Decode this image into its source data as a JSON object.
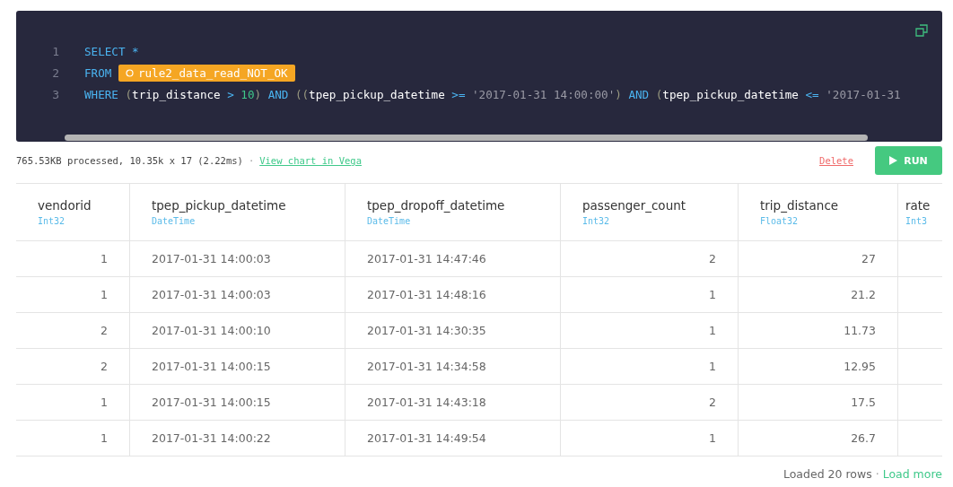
{
  "editor": {
    "lines": [
      {
        "number": "1",
        "tokens": [
          {
            "kind": "keyword",
            "text": "SELECT"
          },
          {
            "kind": "operator",
            "text": "*"
          }
        ]
      },
      {
        "number": "2",
        "tokens": [
          {
            "kind": "keyword",
            "text": "FROM"
          },
          {
            "kind": "table",
            "text": "rule2_data_read_NOT_OK"
          }
        ]
      },
      {
        "number": "3",
        "tokens": [
          {
            "kind": "keyword",
            "text": "WHERE"
          },
          {
            "kind": "paren_open",
            "text": "("
          },
          {
            "kind": "ident",
            "text": "trip_distance"
          },
          {
            "kind": "operator",
            "text": ">"
          },
          {
            "kind": "number",
            "text": "10"
          },
          {
            "kind": "paren_close",
            "text": ")"
          },
          {
            "kind": "keyword",
            "text": "AND"
          },
          {
            "kind": "paren_open",
            "text": "(("
          },
          {
            "kind": "ident",
            "text": "tpep_pickup_datetime"
          },
          {
            "kind": "operator",
            "text": ">="
          },
          {
            "kind": "string",
            "text": "'2017-01-31 14:00:00'"
          },
          {
            "kind": "paren_close",
            "text": ")"
          },
          {
            "kind": "keyword",
            "text": "AND"
          },
          {
            "kind": "paren_open",
            "text": "("
          },
          {
            "kind": "ident",
            "text": "tpep_pickup_datetime"
          },
          {
            "kind": "operator",
            "text": "<="
          },
          {
            "kind": "string",
            "text": "'2017-01-31"
          }
        ]
      }
    ]
  },
  "status": {
    "summary": "765.53KB processed, 10.35k x 17 (2.22ms)",
    "separator": "·",
    "link": "View chart in Vega"
  },
  "actions": {
    "delete": "Delete",
    "run": "RUN"
  },
  "table": {
    "columns": [
      {
        "name": "vendorid",
        "type": "Int32",
        "kind": "number"
      },
      {
        "name": "tpep_pickup_datetime",
        "type": "DateTime",
        "kind": "datetime"
      },
      {
        "name": "tpep_dropoff_datetime",
        "type": "DateTime",
        "kind": "datetime"
      },
      {
        "name": "passenger_count",
        "type": "Int32",
        "kind": "number"
      },
      {
        "name": "trip_distance",
        "type": "Float32",
        "kind": "number"
      },
      {
        "name": "rate",
        "type": "Int3"
      }
    ],
    "rows": [
      [
        "1",
        "2017-01-31 14:00:03",
        "2017-01-31 14:47:46",
        "2",
        "27"
      ],
      [
        "1",
        "2017-01-31 14:00:03",
        "2017-01-31 14:48:16",
        "1",
        "21.2"
      ],
      [
        "2",
        "2017-01-31 14:00:10",
        "2017-01-31 14:30:35",
        "1",
        "11.73"
      ],
      [
        "2",
        "2017-01-31 14:00:15",
        "2017-01-31 14:34:58",
        "1",
        "12.95"
      ],
      [
        "1",
        "2017-01-31 14:00:15",
        "2017-01-31 14:43:18",
        "2",
        "17.5"
      ],
      [
        "1",
        "2017-01-31 14:00:22",
        "2017-01-31 14:49:54",
        "1",
        "26.7"
      ]
    ]
  },
  "footer": {
    "loaded": "Loaded 20 rows",
    "separator": "·",
    "link": "Load more"
  }
}
